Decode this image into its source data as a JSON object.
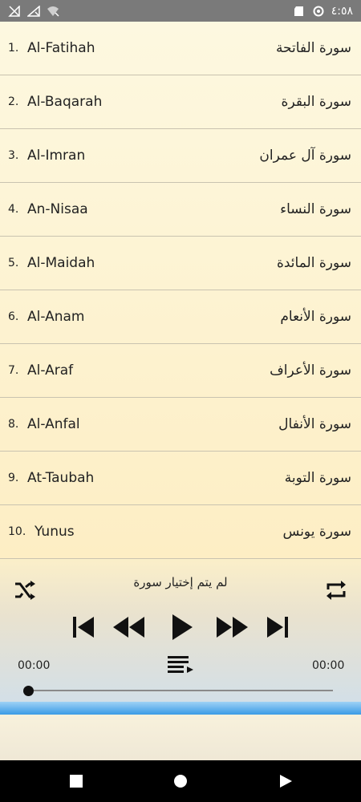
{
  "status_bar": {
    "time": "٤:٥٨"
  },
  "surahs": [
    {
      "num": "1.",
      "latin": "Al-Fatihah",
      "arabic": "سورة الفاتحة"
    },
    {
      "num": "2.",
      "latin": "Al-Baqarah",
      "arabic": "سورة البقرة"
    },
    {
      "num": "3.",
      "latin": "Al-Imran",
      "arabic": "سورة آل عمران"
    },
    {
      "num": "4.",
      "latin": "An-Nisaa",
      "arabic": "سورة النساء"
    },
    {
      "num": "5.",
      "latin": "Al-Maidah",
      "arabic": "سورة المائدة"
    },
    {
      "num": "6.",
      "latin": "Al-Anam",
      "arabic": "سورة الأنعام"
    },
    {
      "num": "7.",
      "latin": "Al-Araf",
      "arabic": "سورة الأعراف"
    },
    {
      "num": "8.",
      "latin": "Al-Anfal",
      "arabic": "سورة الأنفال"
    },
    {
      "num": "9.",
      "latin": "At-Taubah",
      "arabic": "سورة التوبة"
    },
    {
      "num": "10.",
      "latin": "Yunus",
      "arabic": "سورة يونس"
    }
  ],
  "player": {
    "now_playing": "لم يتم إختيار سورة",
    "elapsed": "00:00",
    "duration": "00:00",
    "progress": 0
  }
}
